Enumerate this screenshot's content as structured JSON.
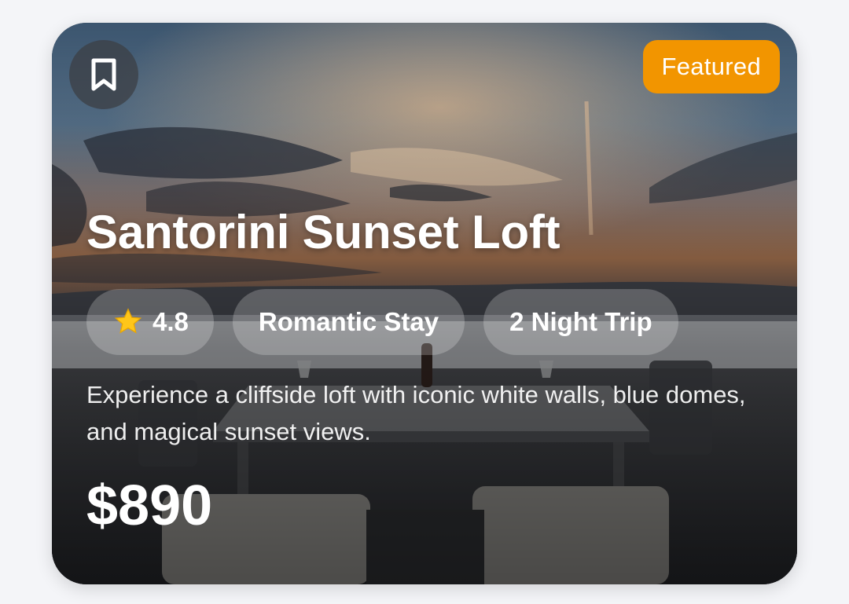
{
  "card": {
    "featured_label": "Featured",
    "title": "Santorini Sunset Loft",
    "rating": "4.8",
    "tags": [
      "Romantic Stay",
      "2 Night Trip"
    ],
    "description": "Experience a cliffside loft with iconic white walls, blue domes, and magical sunset views.",
    "price": "$890"
  },
  "icons": {
    "bookmark": "bookmark-outline-icon",
    "rating": "star-icon"
  },
  "colors": {
    "featured_badge": "#f29500",
    "star": "#ffc61a",
    "page_background": "#f4f5f8"
  }
}
